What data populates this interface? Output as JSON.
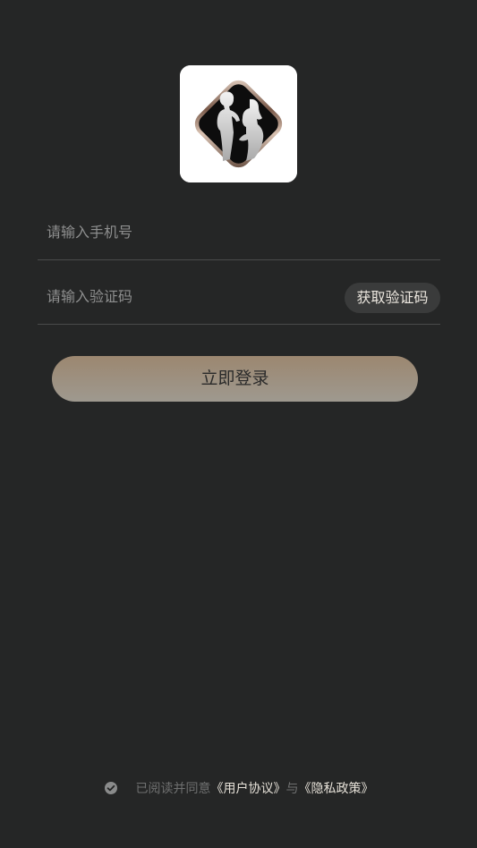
{
  "colors": {
    "background": "#252626",
    "divider": "#4a4b4b",
    "placeholder": "#8e8f8f",
    "code_button_bg": "#3a3b3b",
    "login_gradient_top": "#9c8770",
    "login_gradient_bottom": "#9e998f",
    "link": "#e6e1d8",
    "muted": "#6f7070"
  },
  "logo": {
    "icon": "couple-silhouette-logo"
  },
  "phone_field": {
    "placeholder": "请输入手机号",
    "value": ""
  },
  "code_field": {
    "placeholder": "请输入验证码",
    "value": "",
    "send_code_label": "获取验证码"
  },
  "login_button": {
    "label": "立即登录"
  },
  "agreement": {
    "checked": true,
    "check_icon": "check-circle-icon",
    "prefix": "已阅读并同意",
    "user_agreement": "《用户协议》",
    "joiner": "与",
    "privacy_policy": "《隐私政策》"
  }
}
